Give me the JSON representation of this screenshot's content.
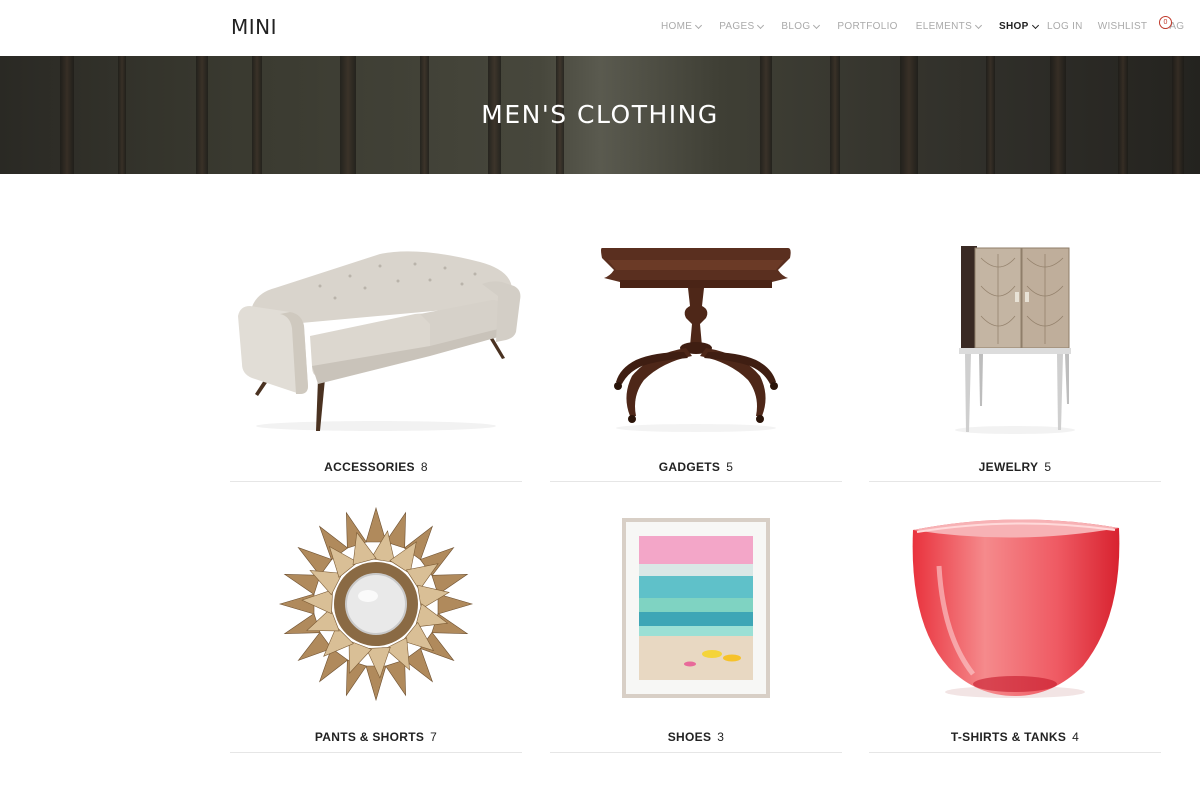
{
  "header": {
    "logo": "MINI",
    "nav": [
      {
        "label": "HOME",
        "dropdown": true,
        "active": false
      },
      {
        "label": "PAGES",
        "dropdown": true,
        "active": false
      },
      {
        "label": "BLOG",
        "dropdown": true,
        "active": false
      },
      {
        "label": "PORTFOLIO",
        "dropdown": false,
        "active": false
      },
      {
        "label": "ELEMENTS",
        "dropdown": true,
        "active": false
      },
      {
        "label": "SHOP",
        "dropdown": true,
        "active": true
      }
    ],
    "account": {
      "login": "LOG IN",
      "wishlist": "WISHLIST",
      "bag": "BAG",
      "bag_count": "0"
    }
  },
  "banner": {
    "title": "MEN'S CLOTHING"
  },
  "categories": [
    {
      "name": "ACCESSORIES",
      "count": "8",
      "image": "sofa-image"
    },
    {
      "name": "GADGETS",
      "count": "5",
      "image": "table-image"
    },
    {
      "name": "JEWELRY",
      "count": "5",
      "image": "cabinet-image"
    },
    {
      "name": "PANTS & SHORTS",
      "count": "7",
      "image": "sunburst-mirror-image"
    },
    {
      "name": "SHOES",
      "count": "3",
      "image": "framed-painting-image"
    },
    {
      "name": "T-SHIRTS & TANKS",
      "count": "4",
      "image": "glass-bowl-image"
    }
  ],
  "colors": {
    "accent": "#c0392b",
    "nav_inactive": "#aaaaaa",
    "text": "#222222"
  }
}
